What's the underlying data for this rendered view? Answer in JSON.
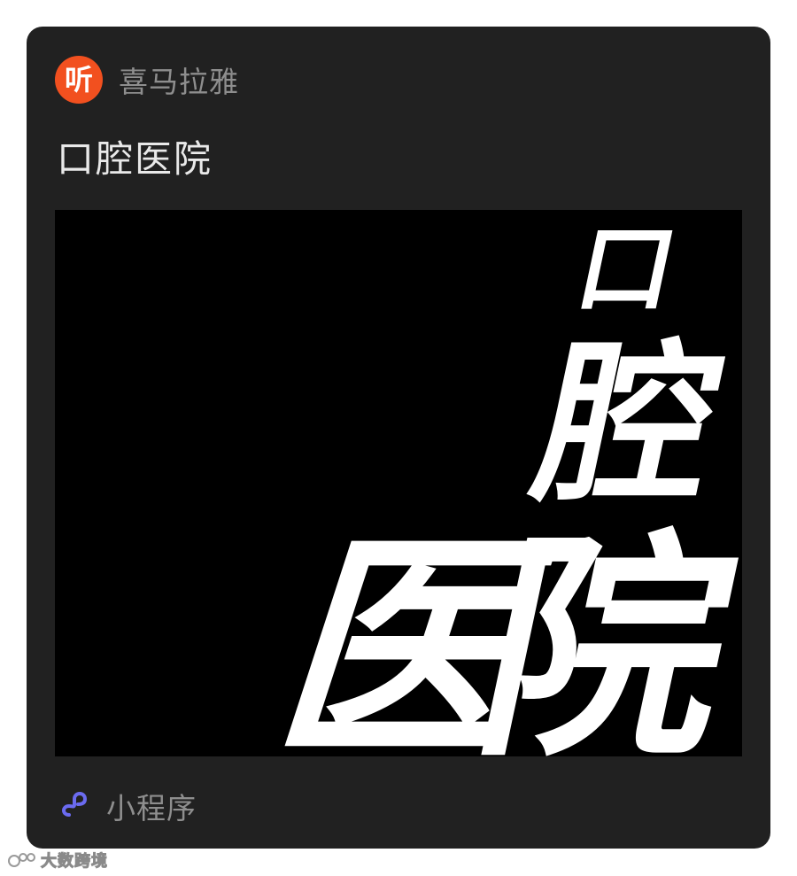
{
  "app": {
    "name": "喜马拉雅",
    "icon_glyph": "听",
    "icon_color": "#f2501f"
  },
  "card": {
    "title": "口腔医院",
    "cover_text": [
      "口",
      "腔",
      "医",
      "院"
    ]
  },
  "footer": {
    "label": "小程序",
    "link_icon_color": "#6b6bf0"
  },
  "watermark": {
    "text": "大数跨境"
  }
}
